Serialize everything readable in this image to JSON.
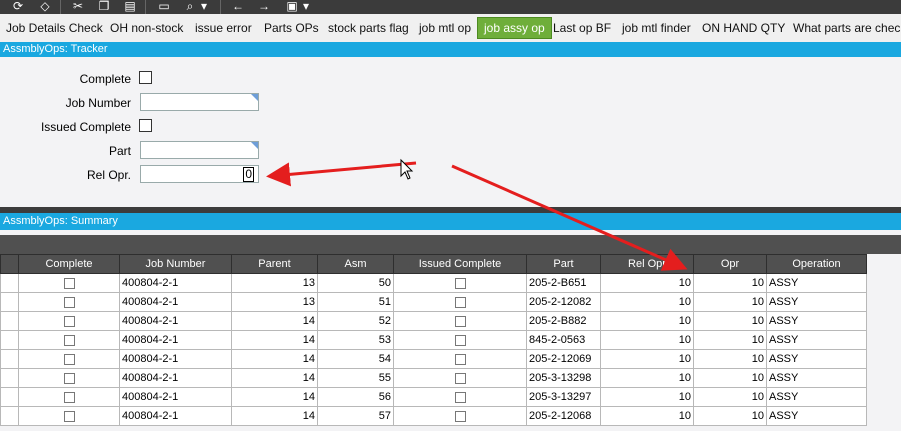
{
  "toolbar": {
    "icons": [
      "refresh-icon",
      "tag-icon",
      "cut-icon",
      "copy-icon",
      "paste-icon",
      "print-icon",
      "print-preview-icon",
      "back-icon",
      "forward-icon",
      "save-icon"
    ]
  },
  "tabs": [
    {
      "label": "Job Details Check",
      "active": false
    },
    {
      "label": "OH non-stock",
      "active": false
    },
    {
      "label": "issue error",
      "active": false
    },
    {
      "label": "Parts OPs",
      "active": false
    },
    {
      "label": "stock parts flag",
      "active": false
    },
    {
      "label": "job mtl op",
      "active": false
    },
    {
      "label": "job assy op",
      "active": true
    },
    {
      "label": "Last op BF",
      "active": false
    },
    {
      "label": "job mtl finder",
      "active": false
    },
    {
      "label": "ON HAND QTY",
      "active": false
    },
    {
      "label": "What parts are check",
      "active": false
    }
  ],
  "tracker": {
    "title": "AssmblyOps: Tracker",
    "fields": {
      "complete_label": "Complete",
      "job_number_label": "Job Number",
      "issued_complete_label": "Issued Complete",
      "part_label": "Part",
      "rel_opr_label": "Rel Opr.",
      "rel_opr_value": "0"
    }
  },
  "summary": {
    "title": "AssmblyOps: Summary",
    "columns": [
      "Complete",
      "Job Number",
      "Parent",
      "Asm",
      "Issued Complete",
      "Part",
      "Rel Opr",
      "Opr",
      "Operation"
    ],
    "rows": [
      {
        "job": "400804-2-1",
        "parent": "13",
        "asm": "50",
        "part": "205-2-B651",
        "relopr": "10",
        "opr": "10",
        "operation": "ASSY"
      },
      {
        "job": "400804-2-1",
        "parent": "13",
        "asm": "51",
        "part": "205-2-12082",
        "relopr": "10",
        "opr": "10",
        "operation": "ASSY"
      },
      {
        "job": "400804-2-1",
        "parent": "14",
        "asm": "52",
        "part": "205-2-B882",
        "relopr": "10",
        "opr": "10",
        "operation": "ASSY"
      },
      {
        "job": "400804-2-1",
        "parent": "14",
        "asm": "53",
        "part": "845-2-0563",
        "relopr": "10",
        "opr": "10",
        "operation": "ASSY"
      },
      {
        "job": "400804-2-1",
        "parent": "14",
        "asm": "54",
        "part": "205-2-12069",
        "relopr": "10",
        "opr": "10",
        "operation": "ASSY"
      },
      {
        "job": "400804-2-1",
        "parent": "14",
        "asm": "55",
        "part": "205-3-13298",
        "relopr": "10",
        "opr": "10",
        "operation": "ASSY"
      },
      {
        "job": "400804-2-1",
        "parent": "14",
        "asm": "56",
        "part": "205-3-13297",
        "relopr": "10",
        "opr": "10",
        "operation": "ASSY"
      },
      {
        "job": "400804-2-1",
        "parent": "14",
        "asm": "57",
        "part": "205-2-12068",
        "relopr": "10",
        "opr": "10",
        "operation": "ASSY"
      }
    ]
  },
  "colors": {
    "accent_blue": "#1aa8e0",
    "active_tab": "#6fae3a",
    "arrow": "#e41e1e",
    "dark_bar": "#505050"
  }
}
